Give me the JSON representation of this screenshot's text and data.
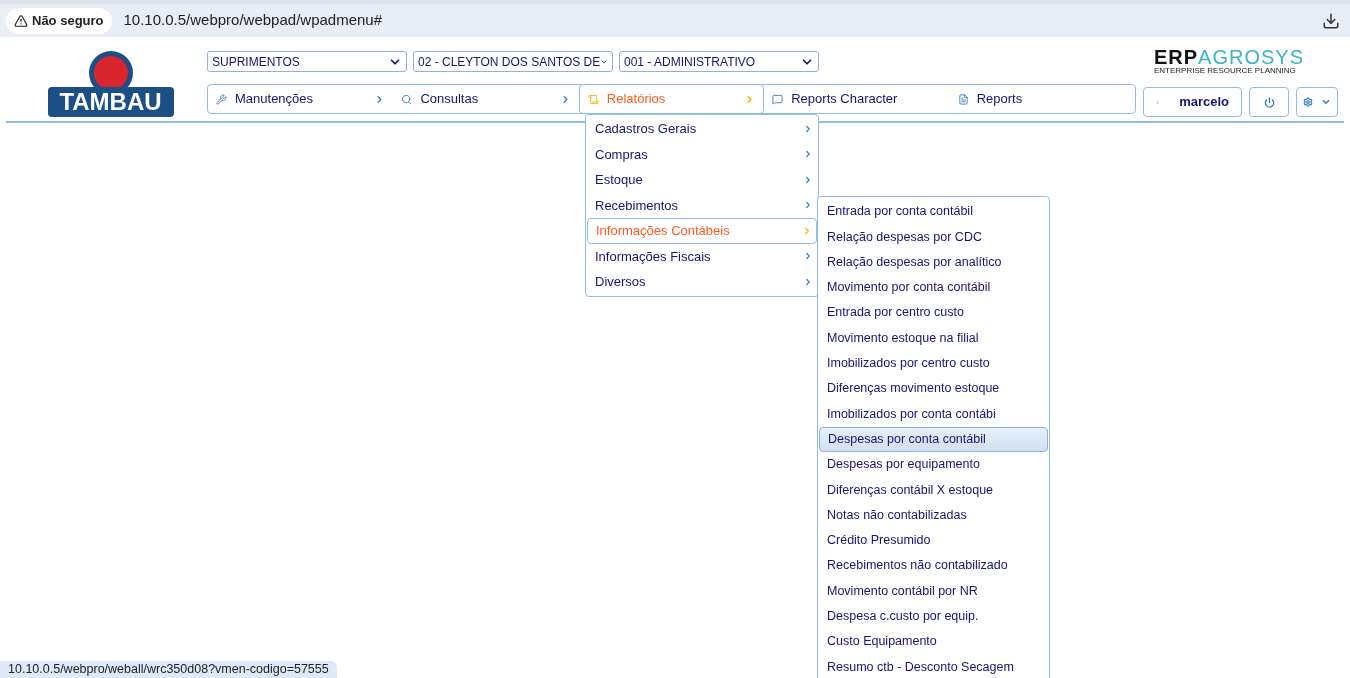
{
  "browser": {
    "security_label": "Não seguro",
    "url": "10.10.0.5/webpro/webpad/wpadmenu#"
  },
  "logo": {
    "text": "TAMBAU"
  },
  "selects": [
    {
      "value": "SUPRIMENTOS"
    },
    {
      "value": "02 - CLEYTON DOS SANTOS DE"
    },
    {
      "value": "001 - ADMINISTRATIVO"
    }
  ],
  "brand": {
    "part_1": "ERP",
    "part_2": "AGROSYS",
    "tagline": "ENTERPRISE RESOURCE PLANNING"
  },
  "nav": [
    {
      "label": "Manutenções",
      "selected": false,
      "has_submenu": true
    },
    {
      "label": "Consultas",
      "selected": false,
      "has_submenu": true
    },
    {
      "label": "Relatórios",
      "selected": true,
      "has_submenu": true
    },
    {
      "label": "Reports Character",
      "selected": false,
      "has_submenu": false
    },
    {
      "label": "Reports",
      "selected": false,
      "has_submenu": false
    }
  ],
  "user": {
    "name": "marcelo"
  },
  "menu": [
    {
      "label": "Cadastros Gerais",
      "selected": false
    },
    {
      "label": "Compras",
      "selected": false
    },
    {
      "label": "Estoque",
      "selected": false
    },
    {
      "label": "Recebimentos",
      "selected": false
    },
    {
      "label": "Informações Contábeis",
      "selected": true
    },
    {
      "label": "Informações Fiscais",
      "selected": false
    },
    {
      "label": "Diversos",
      "selected": false
    }
  ],
  "submenu": [
    {
      "label": "Entrada por conta contábil",
      "selected": false
    },
    {
      "label": "Relação despesas por CDC",
      "selected": false
    },
    {
      "label": "Relação despesas por analítico",
      "selected": false
    },
    {
      "label": "Movimento por conta contábil",
      "selected": false
    },
    {
      "label": "Entrada por centro custo",
      "selected": false
    },
    {
      "label": "Movimento estoque na filial",
      "selected": false
    },
    {
      "label": "Imobilizados por centro custo",
      "selected": false
    },
    {
      "label": "Diferenças movimento estoque",
      "selected": false
    },
    {
      "label": "Imobilizados por conta contábi",
      "selected": false
    },
    {
      "label": "Despesas por conta contábil",
      "selected": true
    },
    {
      "label": "Despesas por equipamento",
      "selected": false
    },
    {
      "label": "Diferenças contábil X estoque",
      "selected": false
    },
    {
      "label": "Notas não contabilizadas",
      "selected": false
    },
    {
      "label": "Crédito Presumido",
      "selected": false
    },
    {
      "label": "Recebimentos não contabilizado",
      "selected": false
    },
    {
      "label": "Movimento contábil por NR",
      "selected": false
    },
    {
      "label": "Despesa c.custo por equip.",
      "selected": false
    },
    {
      "label": "Custo Equipamento",
      "selected": false
    },
    {
      "label": "Resumo ctb - Desconto Secagem",
      "selected": false
    }
  ],
  "status_url": "10.10.0.5/webpro/weball/wrc350d08?vmen-codigo=57555"
}
